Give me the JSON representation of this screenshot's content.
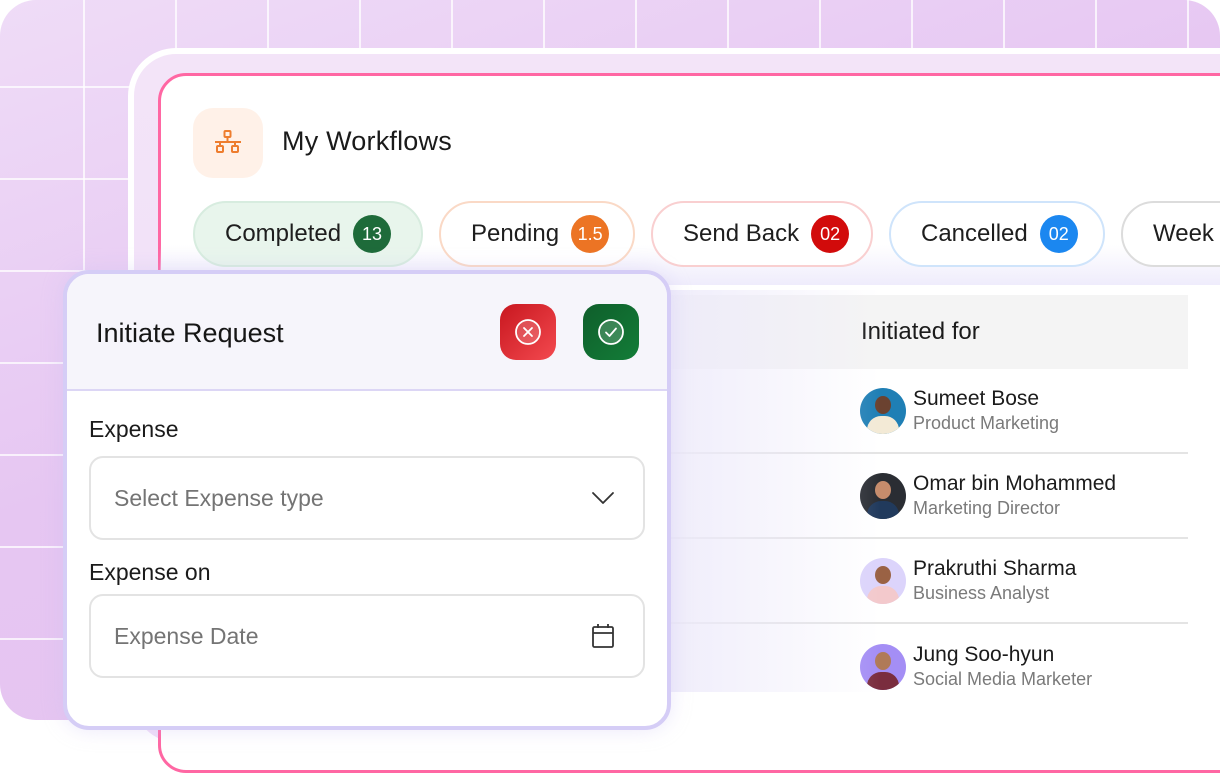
{
  "page": {
    "title": "My Workflows",
    "header_icon": "workflow-hierarchy-icon",
    "accent_border": "#ff67a3"
  },
  "filters": [
    {
      "label": "Completed",
      "count": "13",
      "badge_color": "#1e6b3a"
    },
    {
      "label": "Pending",
      "count": "1.5",
      "badge_color": "#ec7424"
    },
    {
      "label": "Send Back",
      "count": "02",
      "badge_color": "#d20b0b"
    },
    {
      "label": "Cancelled",
      "count": "02",
      "badge_color": "#1b87f0"
    },
    {
      "label": "Week"
    }
  ],
  "table": {
    "columns": [
      "Initiated for"
    ],
    "rows": [
      {
        "name": "Sumeet Bose",
        "role": "Product Marketing"
      },
      {
        "name": "Omar bin Mohammed",
        "role": "Marketing Director"
      },
      {
        "name": "Prakruthi Sharma",
        "role": "Business Analyst"
      },
      {
        "name": "Jung Soo-hyun",
        "role": "Social Media Marketer"
      }
    ]
  },
  "panel": {
    "title": "Initiate Request",
    "cancel_icon": "close-circle-icon",
    "confirm_icon": "check-circle-icon",
    "fields": [
      {
        "label": "Expense",
        "placeholder": "Select Expense type",
        "icon": "chevron-down-icon"
      },
      {
        "label": "Expense on",
        "placeholder": "Expense Date",
        "icon": "calendar-icon"
      }
    ]
  }
}
